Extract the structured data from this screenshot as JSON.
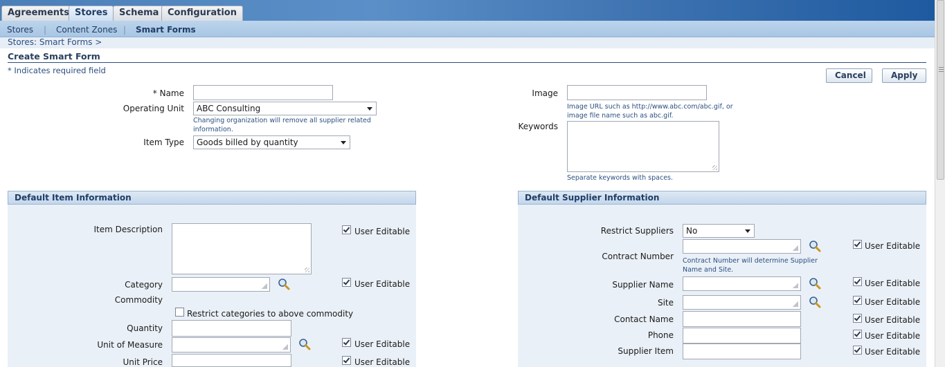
{
  "tabs": [
    {
      "label": "Agreements",
      "active": false
    },
    {
      "label": "Stores",
      "active": true
    },
    {
      "label": "Schema",
      "active": false
    },
    {
      "label": "Configuration",
      "active": false
    }
  ],
  "subnav": {
    "items": [
      "Stores",
      "Content Zones",
      "Smart Forms"
    ],
    "active": "Smart Forms"
  },
  "breadcrumb": "Stores: Smart Forms  >",
  "page_title": "Create Smart Form",
  "required_note": "* Indicates required field",
  "actions": {
    "cancel": "Cancel",
    "apply": "Apply"
  },
  "form": {
    "name_label": "* Name",
    "name_value": "",
    "operating_unit_label": "Operating Unit",
    "operating_unit_value": "ABC Consulting",
    "operating_unit_hint": "Changing organization will remove all supplier related information.",
    "item_type_label": "Item Type",
    "item_type_value": "Goods billed by quantity",
    "image_label": "Image",
    "image_value": "",
    "image_hint": "Image URL such as http://www.abc.com/abc.gif, or image file name such as abc.gif.",
    "keywords_label": "Keywords",
    "keywords_hint": "Separate keywords with spaces."
  },
  "item_section": {
    "title": "Default Item Information",
    "item_description_label": "Item Description",
    "category_label": "Category",
    "commodity_label": "Commodity",
    "restrict_categories_label": "Restrict categories to above commodity",
    "quantity_label": "Quantity",
    "uom_label": "Unit of Measure",
    "unit_price_label": "Unit Price",
    "user_editable": "User Editable"
  },
  "supplier_section": {
    "title": "Default Supplier Information",
    "restrict_suppliers_label": "Restrict Suppliers",
    "restrict_suppliers_value": "No",
    "contract_number_label": "Contract Number",
    "contract_hint": "Contract Number will determine Supplier Name and Site.",
    "supplier_name_label": "Supplier Name",
    "site_label": "Site",
    "contact_name_label": "Contact Name",
    "phone_label": "Phone",
    "supplier_item_label": "Supplier Item",
    "user_editable": "User Editable"
  },
  "colors": {
    "header_blue": "#3d72b0",
    "link_blue": "#2a4f80",
    "section_bg": "#eaf0f7"
  }
}
